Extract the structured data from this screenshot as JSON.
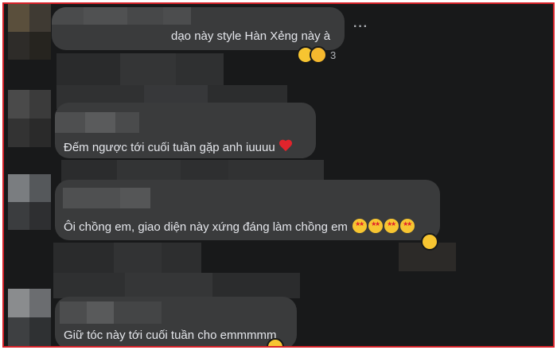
{
  "comments": [
    {
      "text": "dạo này style Hàn Xẻng này à",
      "reaction_count": "3",
      "reaction_icons": [
        "laughing-emoji",
        "surprised-emoji"
      ]
    },
    {
      "text": "Đếm ngược tới cuối tuần gặp anh iuuuu",
      "trailing_emoji": "❤️"
    },
    {
      "text": "Ôi chồng em, giao diện này xứng đáng làm chồng em",
      "trailing_emoji": "🤩🤩🤩🤩"
    },
    {
      "text": "Giữ tóc này tới cuối tuần cho emmmmm"
    }
  ],
  "more_options_label": "···",
  "colors": {
    "background": "#18191a",
    "bubble": "#3a3b3c",
    "text": "#e4e6eb",
    "border": "#d8232a"
  }
}
